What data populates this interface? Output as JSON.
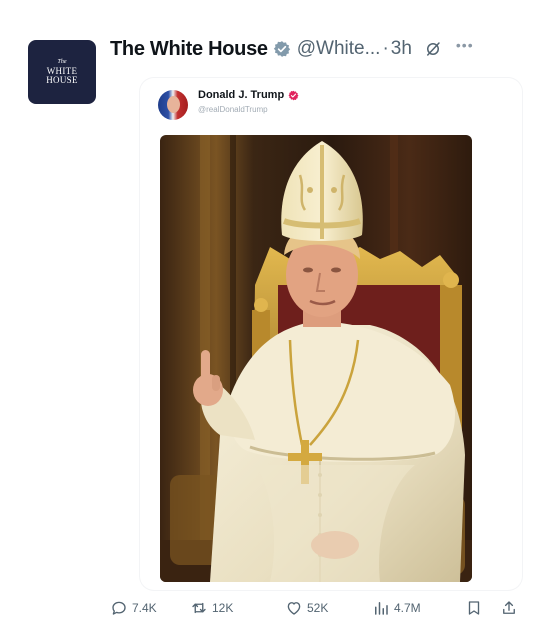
{
  "post": {
    "author": {
      "display_name": "The White House",
      "handle": "@White...",
      "separator": "·",
      "time": "3h",
      "verified": "gray-verified-badge",
      "avatar": {
        "line_the": "The",
        "line1": "WHITE",
        "line2": "HOUSE"
      }
    },
    "embedded": {
      "display_name": "Donald J. Trump",
      "handle": "@realDonaldTrump",
      "verified": "pink-verified-badge",
      "image": "painting-figure-in-papal-vestments"
    },
    "actions": {
      "replies": "7.4K",
      "reposts": "12K",
      "likes": "52K",
      "views": "4.7M"
    },
    "icons": [
      "grok-icon",
      "more-icon",
      "reply-icon",
      "repost-icon",
      "like-icon",
      "views-icon",
      "bookmark-icon",
      "share-icon"
    ]
  },
  "colors": {
    "text": "#0f1419",
    "muted": "#536471",
    "avatar_bg": "#1d2340",
    "badge_gray": "#829aab",
    "badge_pink": "#e0245e"
  }
}
